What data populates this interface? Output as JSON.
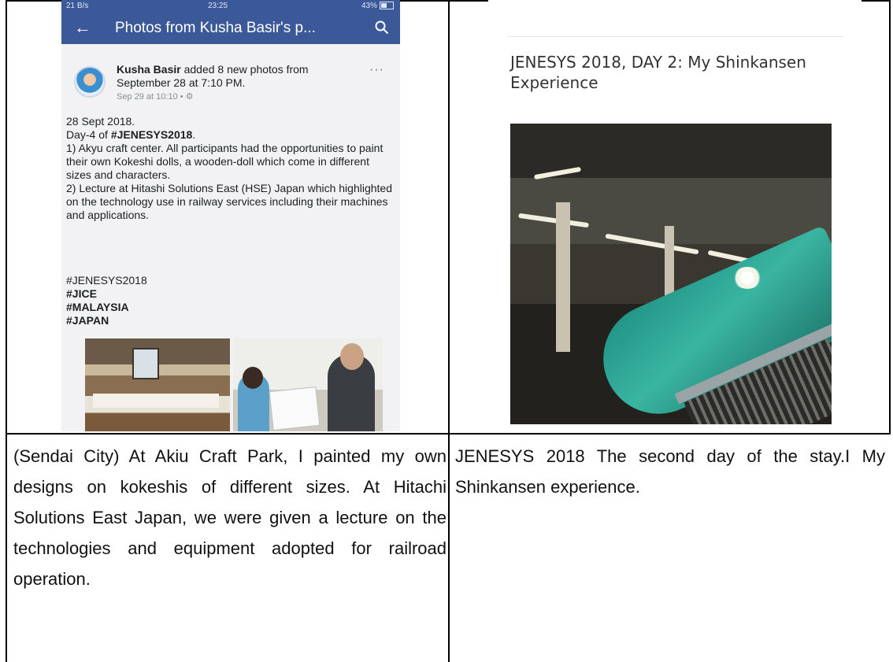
{
  "left_panel": {
    "statusbar": {
      "left": "21 B/s",
      "time": "23:25",
      "right": "43%"
    },
    "appbar": {
      "title": "Photos from Kusha Basir's p..."
    },
    "post": {
      "author": "Kusha Basir",
      "action": "added 8 new photos from September 28 at 7:10 PM.",
      "date": "Sep 29 at 10:10 •",
      "body_line1": "28 Sept 2018.",
      "body_line2_prefix": "Day-4 of ",
      "body_line2_tag": "#JENESYS2018",
      "body_line2_suffix": ".",
      "body_rest": "1) Akyu craft center. All participants had the opportunities to paint their own Kokeshi dolls, a wooden-doll which come in different sizes and characters.\n2) Lecture at Hitashi Solutions East (HSE) Japan which highlighted on the technology use in railway services including their machines and applications.",
      "tags": [
        "#JENESYS2018",
        "#JICE",
        "#MALAYSIA",
        "#JAPAN"
      ]
    },
    "caption": "(Sendai City) At Akiu Craft Park, I painted my own designs on kokeshis of different sizes. At Hitachi Solutions East Japan, we were given a lecture on the technologies and equipment adopted for railroad operation."
  },
  "right_panel": {
    "blog_title": "JENESYS 2018, DAY 2: My Shinkansen Experience",
    "caption": "JENESYS 2018 The second day of the stay.I My Shinkansen experience."
  },
  "colors": {
    "facebook_blue": "#3b5998",
    "border": "#000000"
  }
}
